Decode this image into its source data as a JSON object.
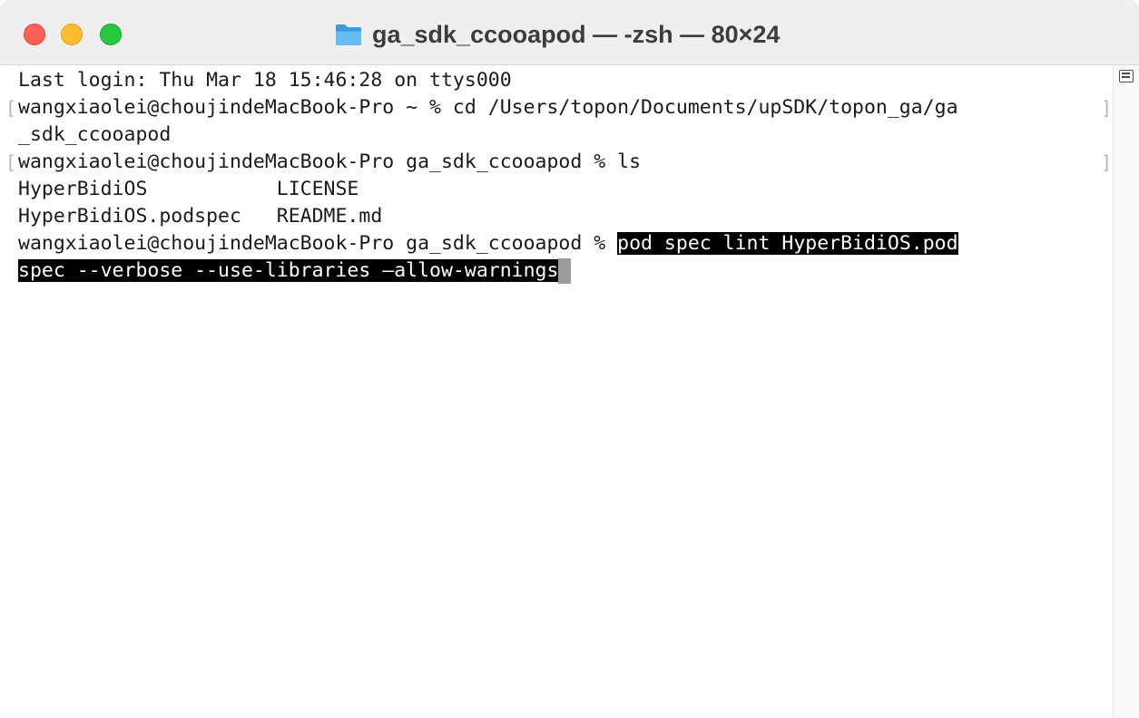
{
  "window": {
    "title": "ga_sdk_ccooapod — -zsh — 80×24",
    "folder_icon": "folder-icon",
    "traffic_lights": {
      "close": "#fe5f57",
      "minimize": "#febc2e",
      "zoom": "#28c840"
    }
  },
  "terminal": {
    "last_login": "Last login: Thu Mar 18 15:46:28 on ttys000",
    "cmd1": "wangxiaolei@choujindeMacBook-Pro ~ % cd /Users/topon/Documents/upSDK/topon_ga/ga",
    "cmd1_wrap": "_sdk_ccooapod",
    "cmd2": "wangxiaolei@choujindeMacBook-Pro ga_sdk_ccooapod % ls",
    "ls_row1": "HyperBidiOS           LICENSE",
    "ls_row2": "HyperBidiOS.podspec   README.md",
    "prompt3": "wangxiaolei@choujindeMacBook-Pro ga_sdk_ccooapod % ",
    "cmd3_part1": "pod spec lint HyperBidiOS.pod",
    "cmd3_part2": "spec --verbose --use-libraries —allow-warnings"
  },
  "colors": {
    "selection_bg": "#000000",
    "selection_fg": "#ffffff",
    "cursor": "#9b9b9b"
  }
}
